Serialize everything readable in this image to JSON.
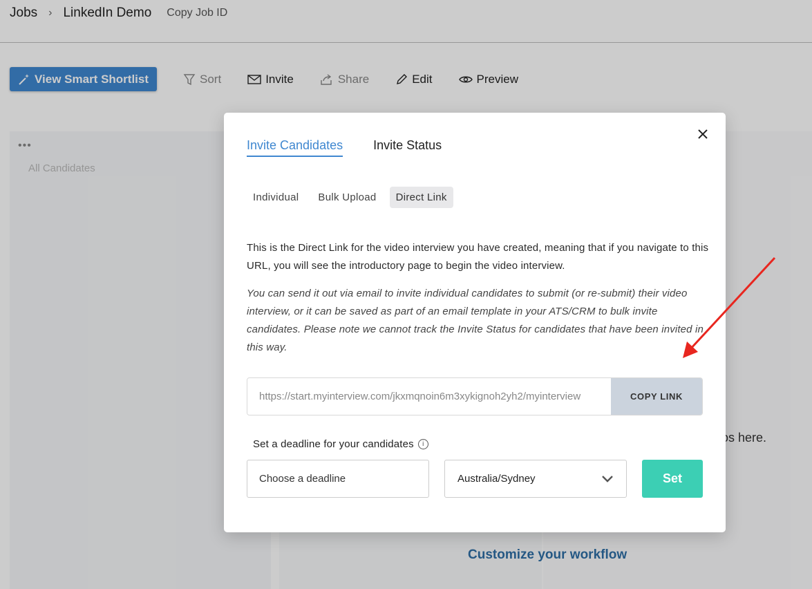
{
  "breadcrumb": {
    "jobs": "Jobs",
    "job_name": "LinkedIn Demo",
    "copy_job_id": "Copy Job ID"
  },
  "toolbar": {
    "smart_shortlist": "View Smart Shortlist",
    "sort": "Sort",
    "invite": "Invite",
    "share": "Share",
    "edit": "Edit",
    "preview": "Preview"
  },
  "background": {
    "column_label": "All Candidates",
    "right_text": "os here.",
    "workflow_link": "Customize your workflow"
  },
  "modal": {
    "tabs": [
      "Invite Candidates",
      "Invite Status"
    ],
    "subtabs": [
      "Individual",
      "Bulk Upload",
      "Direct Link"
    ],
    "active_subtab": "Direct Link",
    "description": "This is the Direct Link for the video interview you have created, meaning that if you navigate to this URL, you will see the introductory page to begin the video interview.",
    "note": "You can send it out via email to invite individual candidates to submit (or re-submit) their video interview, or it can be saved as part of an email template in your ATS/CRM to bulk invite candidates. Please note we cannot track the Invite Status for candidates that have been invited in this way.",
    "link_url": "https://start.myinterview.com/jkxmqnoin6m3xykignoh2yh2/myinterview",
    "copy_link": "COPY LINK",
    "deadline_label": "Set a deadline for your candidates",
    "deadline_placeholder": "Choose a deadline",
    "timezone": "Australia/Sydney",
    "set_button": "Set"
  },
  "colors": {
    "accent_blue": "#3f87d0",
    "set_button_teal": "#3ccfb4",
    "copy_button_bg": "#cbd3dd",
    "annotation_arrow": "#e8261f"
  }
}
